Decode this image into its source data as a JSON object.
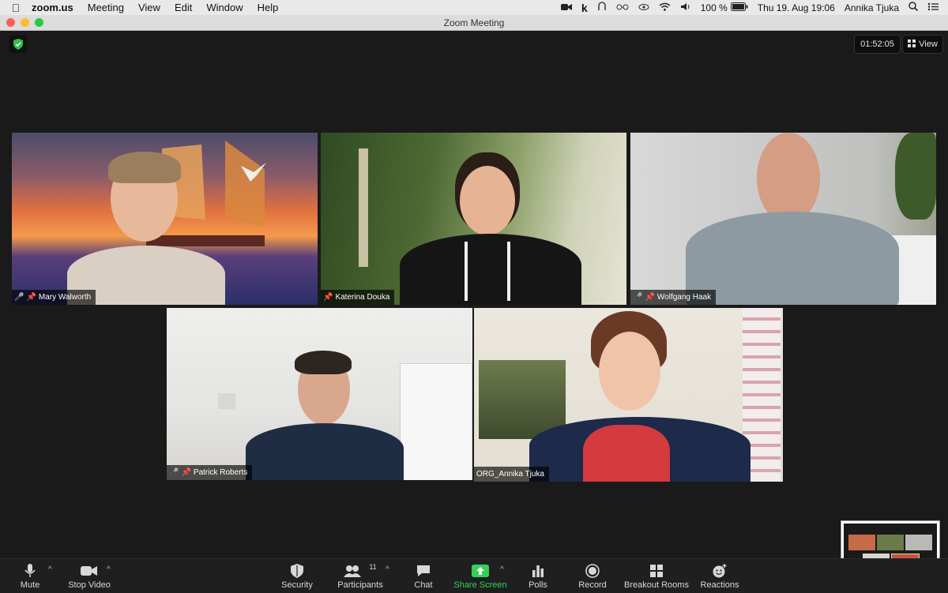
{
  "menubar": {
    "app": "zoom.us",
    "items": [
      "Meeting",
      "View",
      "Edit",
      "Window",
      "Help"
    ],
    "battery": "100 %",
    "datetime": "Thu 19. Aug  19:06",
    "user": "Annika Tjuka"
  },
  "window": {
    "title": "Zoom Meeting"
  },
  "meeting": {
    "timer": "01:52:05",
    "view_label": "View"
  },
  "participants": [
    {
      "name": "Mary Walworth",
      "muted": true
    },
    {
      "name": "Katerina Douka",
      "muted": false
    },
    {
      "name": "Wolfgang Haak",
      "muted": true
    },
    {
      "name": "Patrick Roberts",
      "muted": true
    },
    {
      "name": "ORG_Annika Tjuka",
      "muted": false
    }
  ],
  "toolbar": {
    "mute": "Mute",
    "stop_video": "Stop Video",
    "security": "Security",
    "participants": "Participants",
    "participants_count": "11",
    "chat": "Chat",
    "share_screen": "Share Screen",
    "polls": "Polls",
    "record": "Record",
    "breakout_rooms": "Breakout Rooms",
    "reactions": "Reactions"
  },
  "colors": {
    "active_speaker_border": "#d7e27a",
    "share_green": "#36d058",
    "muted_red": "#e24a4a"
  }
}
